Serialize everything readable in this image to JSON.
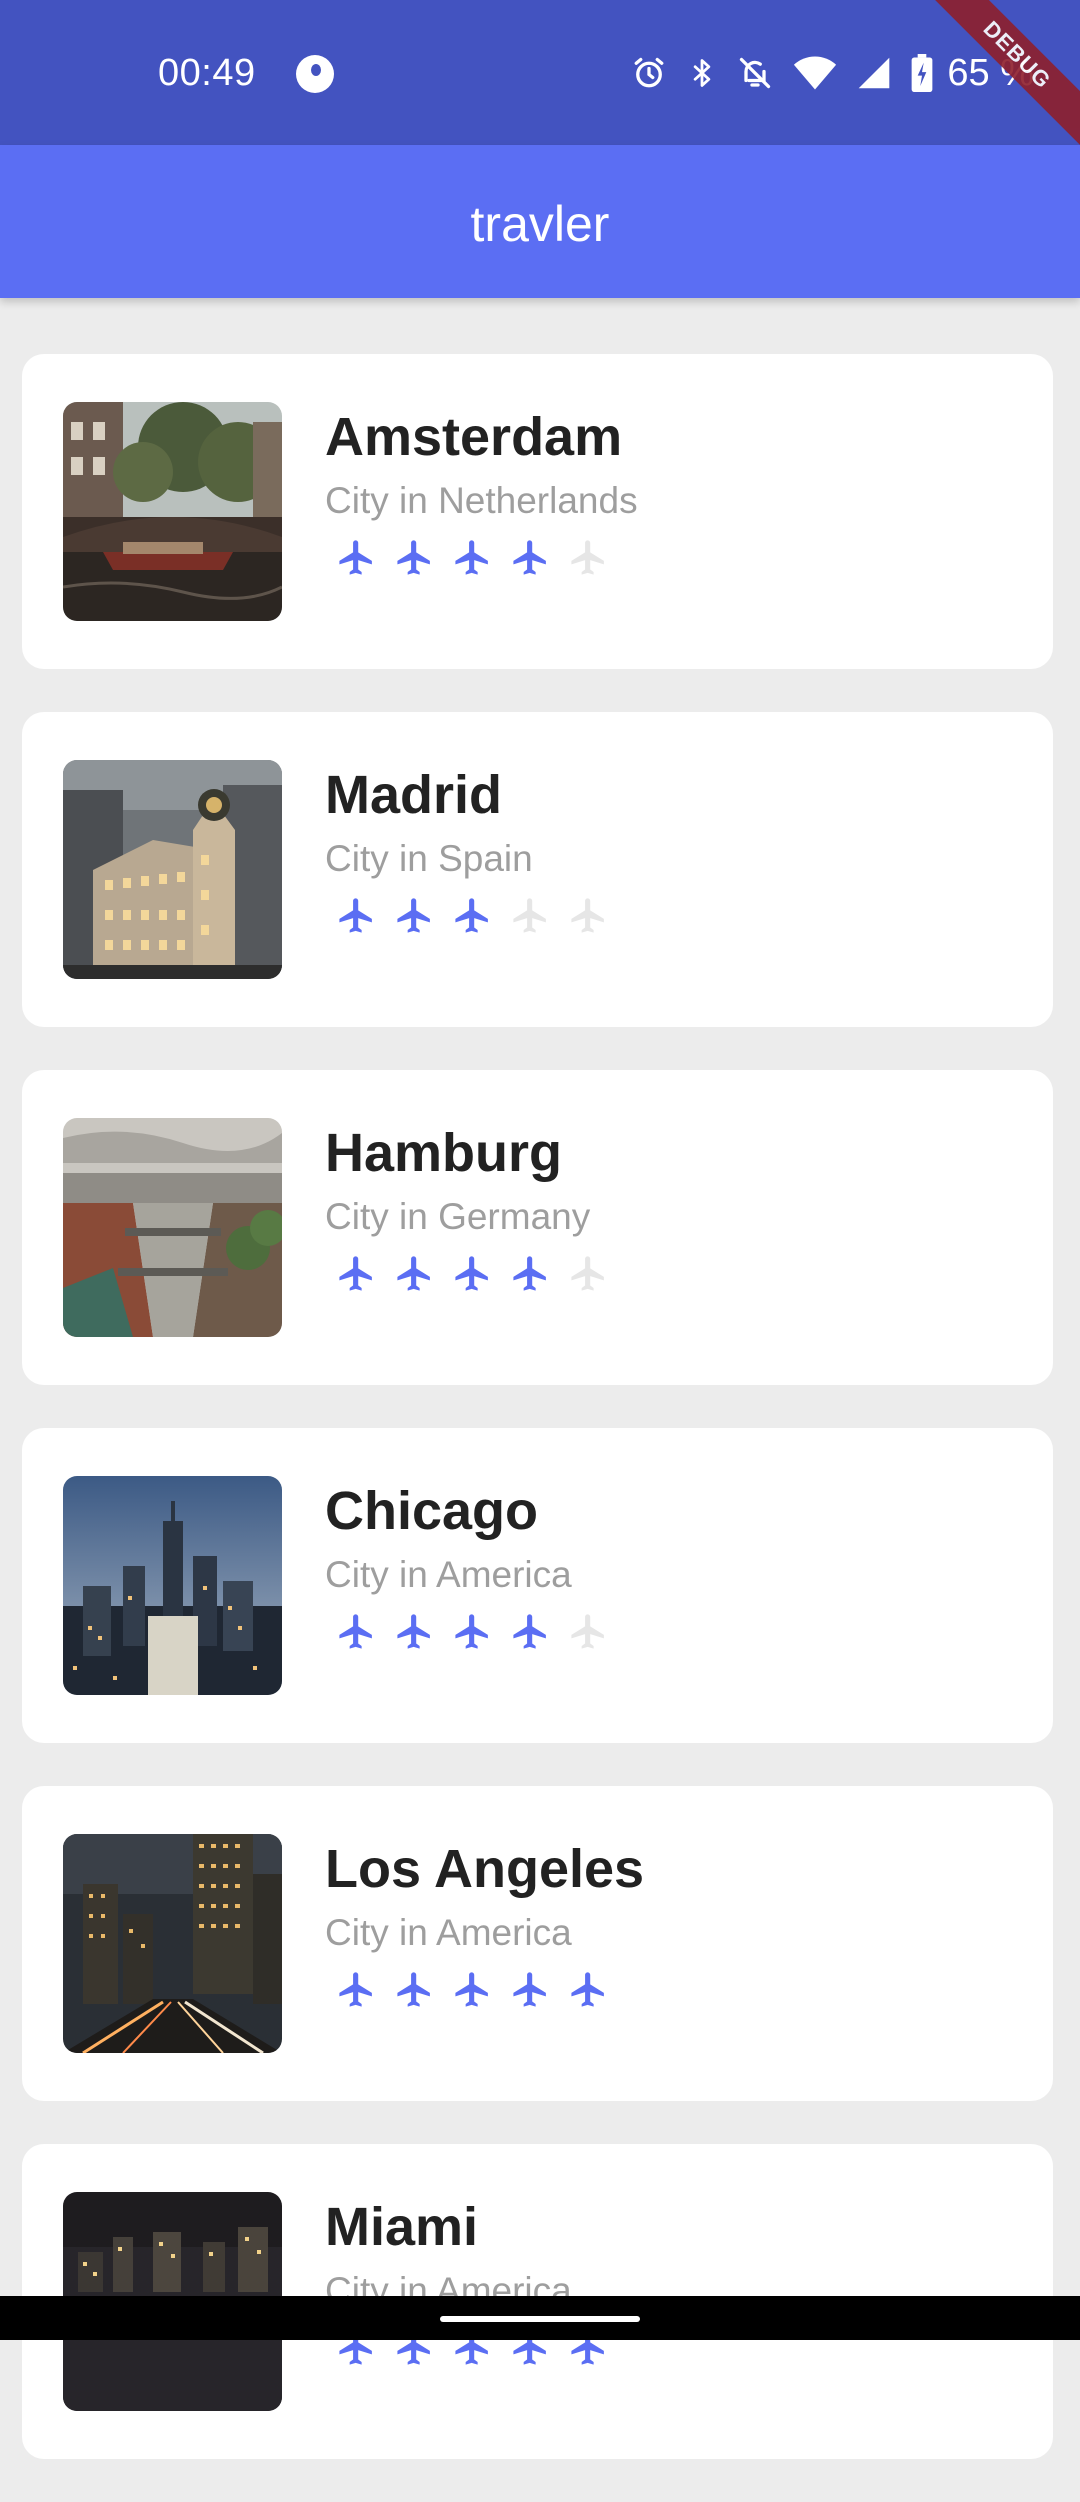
{
  "status_bar": {
    "time": "00:49",
    "battery": "65 %",
    "icons": [
      "app-notification-icon",
      "alarm-icon",
      "bluetooth-icon",
      "do-not-disturb-icon",
      "wifi-icon",
      "cell-signal-icon",
      "battery-charging-icon"
    ]
  },
  "debug_banner": "DEBUG",
  "app_bar": {
    "title": "travler"
  },
  "colors": {
    "status_bar": "#4353c0",
    "app_bar": "#5b6ef3",
    "rating_active": "#5b6ef3",
    "rating_inactive": "#e6e6e6",
    "background": "#ececec"
  },
  "rating_icon": "airplane-icon",
  "rating_max": 5,
  "cities": [
    {
      "name": "Amsterdam",
      "subtitle": "City in Netherlands",
      "rating": 4
    },
    {
      "name": "Madrid",
      "subtitle": "City in Spain",
      "rating": 3
    },
    {
      "name": "Hamburg",
      "subtitle": "City in Germany",
      "rating": 4
    },
    {
      "name": "Chicago",
      "subtitle": "City in America",
      "rating": 4
    },
    {
      "name": "Los Angeles",
      "subtitle": "City in America",
      "rating": 5
    },
    {
      "name": "Miami",
      "subtitle": "City in America",
      "rating": 5
    }
  ]
}
